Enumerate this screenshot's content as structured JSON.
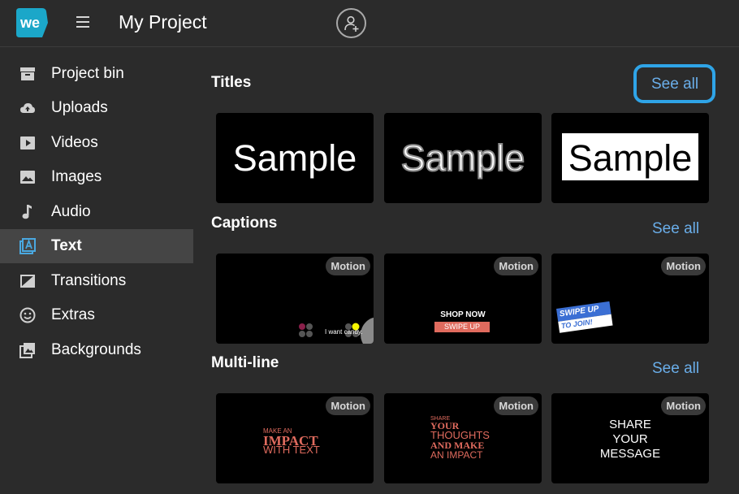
{
  "header": {
    "title": "My Project",
    "logo_text": "we",
    "colors": {
      "logo": "#1ba7c9",
      "accent": "#2fa4e7",
      "link": "#6aaeea"
    }
  },
  "sidebar": {
    "items": [
      {
        "label": "Project bin",
        "icon": "archive-icon"
      },
      {
        "label": "Uploads",
        "icon": "cloud-upload-icon"
      },
      {
        "label": "Videos",
        "icon": "play-icon"
      },
      {
        "label": "Images",
        "icon": "image-icon"
      },
      {
        "label": "Audio",
        "icon": "music-note-icon"
      },
      {
        "label": "Text",
        "icon": "text-icon",
        "active": true
      },
      {
        "label": "Transitions",
        "icon": "transition-icon"
      },
      {
        "label": "Extras",
        "icon": "smiley-icon"
      },
      {
        "label": "Backgrounds",
        "icon": "backgrounds-icon"
      }
    ]
  },
  "sections": [
    {
      "title": "Titles",
      "see_all": "See all",
      "cards": [
        {
          "text": "Sample"
        },
        {
          "text": "Sample"
        },
        {
          "text": "Sample"
        }
      ]
    },
    {
      "title": "Captions",
      "see_all": "See all",
      "cards": [
        {
          "badge": "Motion",
          "caption": "I want candy."
        },
        {
          "badge": "Motion",
          "line1": "SHOP NOW",
          "line2": "SWIPE UP"
        },
        {
          "badge": "Motion",
          "line1": "SWIPE UP",
          "line2": "TO JOIN!"
        }
      ]
    },
    {
      "title": "Multi-line",
      "see_all": "See all",
      "cards": [
        {
          "badge": "Motion",
          "line1": "MAKE AN",
          "line2": "IMPACT",
          "line3": "WITH TEXT"
        },
        {
          "badge": "Motion",
          "line1": "SHARE",
          "line2": "YOUR",
          "line3": "THOUGHTS",
          "line4": "AND MAKE",
          "line5": "AN IMPACT"
        },
        {
          "badge": "Motion",
          "line1": "SHARE",
          "line2": "YOUR",
          "line3": "MESSAGE"
        }
      ]
    }
  ]
}
